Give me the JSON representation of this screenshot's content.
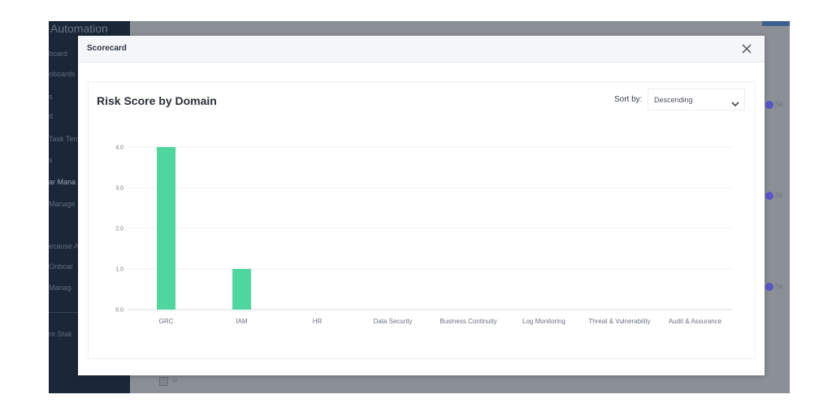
{
  "background_app": {
    "title": "Automation",
    "nav_items": [
      {
        "label": "board",
        "active": false
      },
      {
        "label": "oboards",
        "active": false
      },
      {
        "label": "s",
        "active": false
      },
      {
        "label": "d",
        "active": false
      },
      {
        "label": "Task Ten",
        "active": false
      },
      {
        "label": "s",
        "active": false
      },
      {
        "label": "ar Mana",
        "active": true
      },
      {
        "label": "Manage",
        "active": false
      },
      {
        "label": "ecause A",
        "active": false
      },
      {
        "label": "Onboar",
        "active": false
      },
      {
        "label": "Manag",
        "active": false
      },
      {
        "label": "re Stak",
        "active": false
      }
    ],
    "right_fragments": [
      "Se",
      "Se",
      "Se"
    ],
    "bottom_fragment": "le"
  },
  "modal": {
    "title": "Scorecard",
    "close_icon": "close-icon"
  },
  "card": {
    "title": "Risk Score by Domain",
    "sort_label": "Sort by:",
    "sort_value": "Descending",
    "sort_icon": "chevron-down-icon"
  },
  "chart_data": {
    "type": "bar",
    "categories": [
      "GRC",
      "IAM",
      "HR",
      "Data Security",
      "Business Continuity",
      "Log Monitoring",
      "Threat & Vulnerability",
      "Audit & Assurance"
    ],
    "values": [
      4.0,
      1.0,
      0,
      0,
      0,
      0,
      0,
      0
    ],
    "yticks": [
      "0.0",
      "1.0",
      "2.0",
      "3.0",
      "4.0"
    ],
    "ylim": [
      0,
      4.0
    ],
    "grid": true,
    "bar_color": "#4fd6a0"
  }
}
